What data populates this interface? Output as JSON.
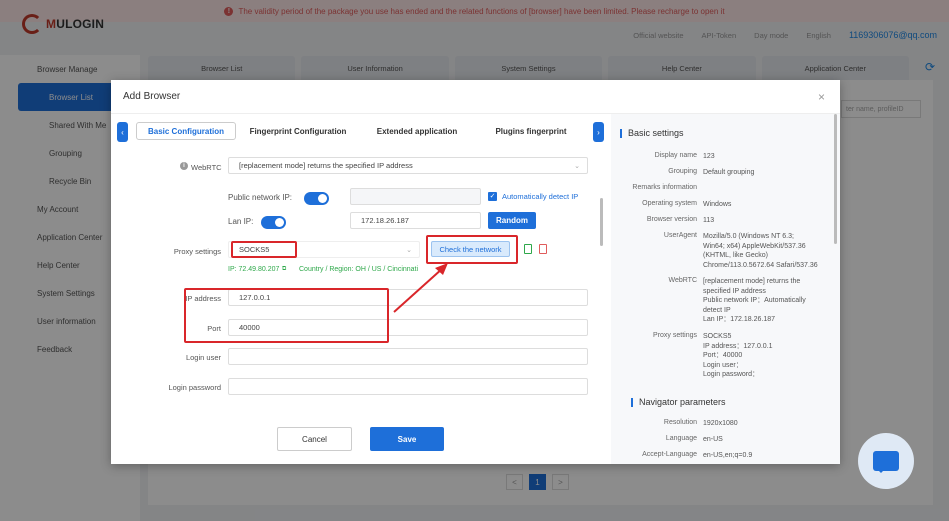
{
  "banner": {
    "icon": "exclamation-circle-icon",
    "text": "The validity period of the package you use has ended and the related functions of [browser] have been limited. Please recharge to open it"
  },
  "brand": {
    "logo_text_m": "M",
    "logo_text_rest": "ULOGIN"
  },
  "topbar": {
    "official_website": "Official website",
    "api_token": "API-Token",
    "day_mode": "Day mode",
    "language": "English",
    "account": "1169306076@qq.com"
  },
  "sidebar": {
    "items": [
      {
        "label": "Browser Manage"
      },
      {
        "label": "Browser List"
      },
      {
        "label": "Shared With Me"
      },
      {
        "label": "Grouping"
      },
      {
        "label": "Recycle Bin"
      },
      {
        "label": "My Account"
      },
      {
        "label": "Application Center"
      },
      {
        "label": "Help Center"
      },
      {
        "label": "System Settings"
      },
      {
        "label": "User information"
      },
      {
        "label": "Feedback"
      }
    ]
  },
  "bg_tabs": [
    "Browser List",
    "User Information",
    "System Settings",
    "Help Center",
    "Application Center"
  ],
  "bg_search_placeholder": "ter name, profileID",
  "pager": {
    "prev": "<",
    "page": "1",
    "next": ">"
  },
  "modal": {
    "title": "Add Browser",
    "close": "×",
    "tabs": [
      "Basic Configuration",
      "Fingerprint Configuration",
      "Extended application",
      "Plugins fingerprint"
    ],
    "active_tab": "Basic Configuration",
    "form": {
      "webrtc_label": "WebRTC",
      "webrtc_value": "[replacement mode] returns the specified IP address",
      "public_ip_label": "Public network IP:",
      "public_ip_value": "",
      "auto_detect_label": "Automatically detect IP",
      "lan_ip_label": "Lan IP:",
      "lan_ip_value": "172.18.26.187",
      "random_button": "Random",
      "proxy_label": "Proxy settings",
      "proxy_value": "SOCKS5",
      "check_network_button": "Check the network",
      "proxy_ip_status": "IP: 72.49.80.207",
      "proxy_region_status": "Country / Region: OH / US / Cincinnati",
      "ip_address_label": "IP address",
      "ip_address_value": "127.0.0.1",
      "port_label": "Port",
      "port_value": "40000",
      "login_user_label": "Login user",
      "login_user_value": "",
      "login_password_label": "Login password",
      "login_password_value": ""
    },
    "cancel_button": "Cancel",
    "save_button": "Save",
    "panel": {
      "basic_title": "Basic settings",
      "basic": [
        {
          "key": "Display name",
          "value": "123"
        },
        {
          "key": "Grouping",
          "value": "Default grouping"
        },
        {
          "key": "Remarks information",
          "value": ""
        },
        {
          "key": "Operating system",
          "value": "Windows"
        },
        {
          "key": "Browser version",
          "value": "113"
        },
        {
          "key": "UserAgent",
          "value": "Mozilla/5.0 (Windows NT 6.3;\nWin64; x64) AppleWebKit/537.36\n(KHTML, like Gecko)\nChrome/113.0.5672.64 Safari/537.36"
        },
        {
          "key": "WebRTC",
          "value": "[replacement mode] returns the\nspecified IP address\nPublic network IP：Automatically\ndetect IP\nLan IP：172.18.26.187"
        },
        {
          "key": "Proxy settings",
          "value": "SOCKS5\nIP address：127.0.0.1\nPort：40000\nLogin user：\nLogin password："
        }
      ],
      "navigator_title": "Navigator parameters",
      "navigator": [
        {
          "key": "Resolution",
          "value": "1920x1080"
        },
        {
          "key": "Language",
          "value": "en-US"
        },
        {
          "key": "Accept-Language",
          "value": "en-US,en;q=0.9"
        }
      ]
    }
  },
  "colors": {
    "accent": "#1e6fd9",
    "annotation": "#d9262a",
    "success": "#2ea84a",
    "banner_text": "#e05c5c"
  }
}
